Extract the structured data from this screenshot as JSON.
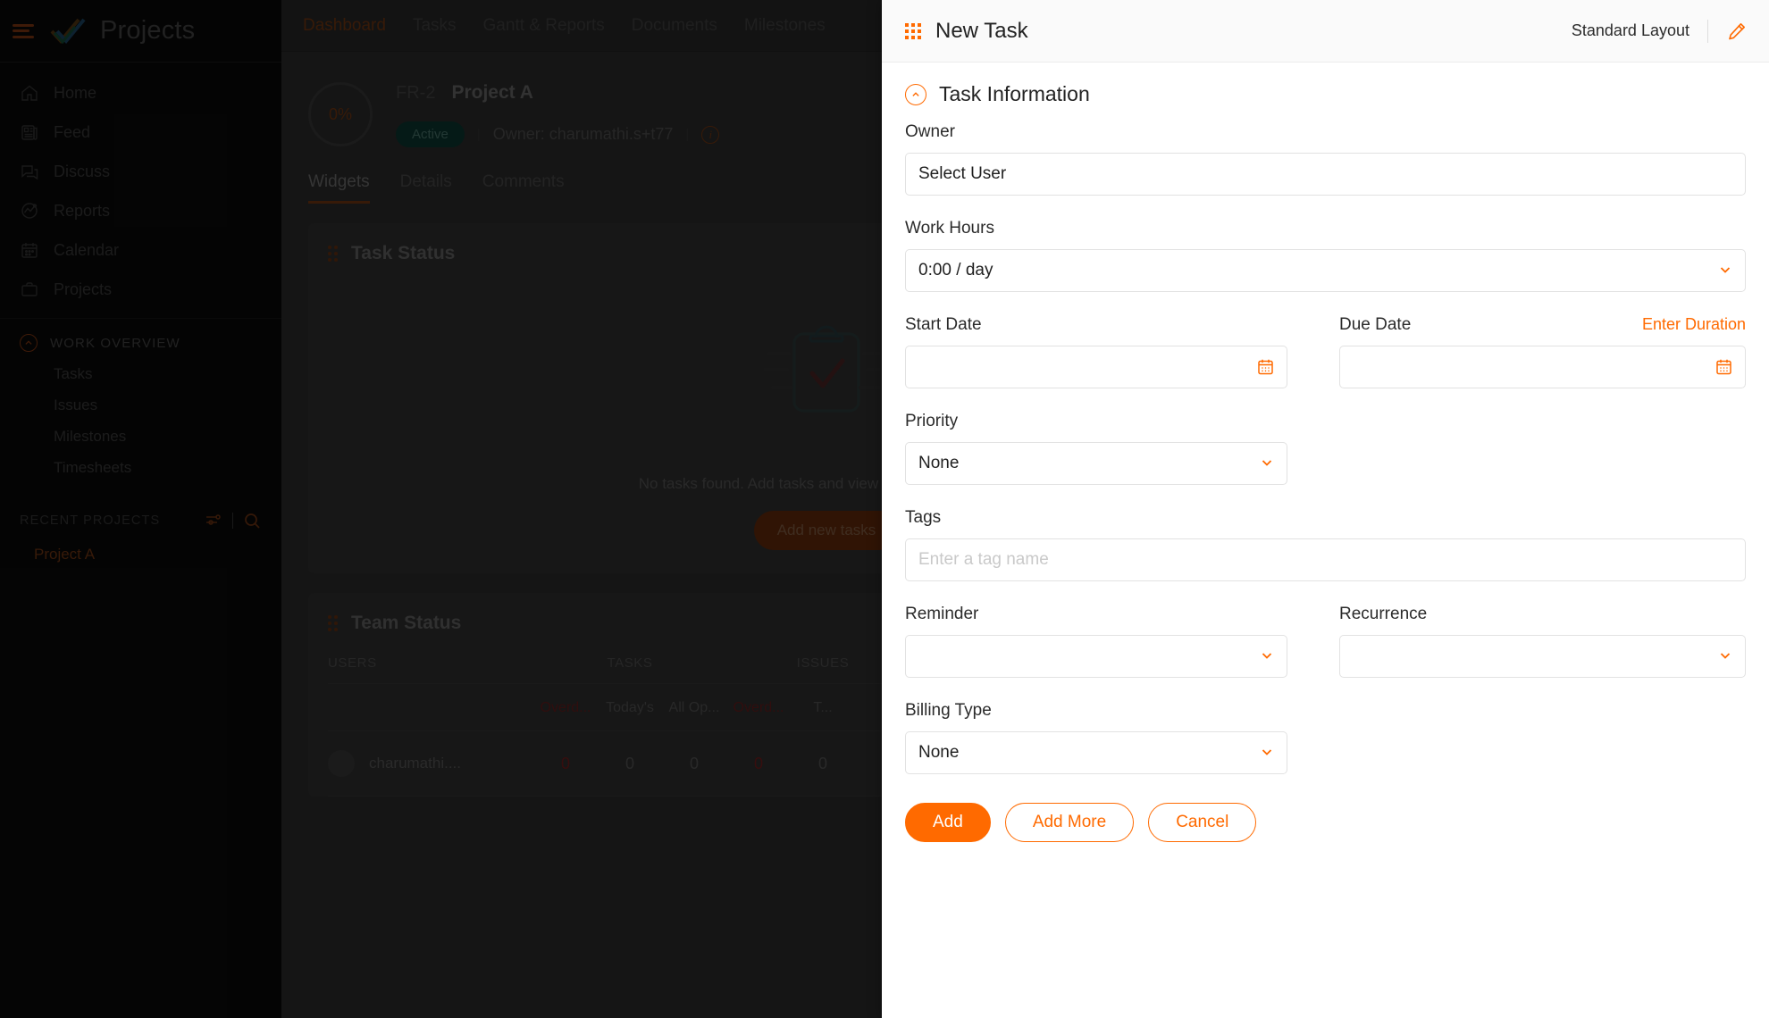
{
  "sidebar": {
    "brand": "Projects",
    "nav": [
      {
        "label": "Home",
        "icon": "home-icon"
      },
      {
        "label": "Feed",
        "icon": "feed-icon"
      },
      {
        "label": "Discuss",
        "icon": "discuss-icon"
      },
      {
        "label": "Reports",
        "icon": "reports-icon"
      },
      {
        "label": "Calendar",
        "icon": "calendar-icon"
      },
      {
        "label": "Projects",
        "icon": "projects-icon"
      }
    ],
    "work_overview": {
      "label": "WORK OVERVIEW",
      "items": [
        "Tasks",
        "Issues",
        "Milestones",
        "Timesheets"
      ]
    },
    "recent": {
      "label": "RECENT PROJECTS",
      "projects": [
        "Project A"
      ]
    }
  },
  "topbar": {
    "tabs": [
      "Dashboard",
      "Tasks",
      "Gantt & Reports",
      "Documents",
      "Milestones"
    ],
    "active": "Dashboard"
  },
  "project": {
    "progress": "0%",
    "key": "FR-2",
    "name": "Project A",
    "status": "Active",
    "owner": "Owner:  charumathi.s+t77",
    "tabs": [
      "Widgets",
      "Details",
      "Comments"
    ],
    "active_tab": "Widgets"
  },
  "task_status_widget": {
    "title": "Task Status",
    "empty_text": "No tasks found. Add tasks and view their progress here.",
    "button": "Add new tasks"
  },
  "team_status_widget": {
    "title": "Team Status",
    "groups": [
      "USERS",
      "TASKS",
      "ISSUES"
    ],
    "subheaders": [
      "Overd...",
      "Today's",
      "All Op...",
      "Overd...",
      "T..."
    ],
    "rows": [
      {
        "user": "charumathi....",
        "values": [
          "0",
          "0",
          "0",
          "0",
          "0"
        ]
      }
    ]
  },
  "panel": {
    "title": "New Task",
    "layout_label": "Standard Layout",
    "section_title": "Task Information",
    "fields": {
      "owner": {
        "label": "Owner",
        "value": "Select User"
      },
      "work_hours": {
        "label": "Work Hours",
        "value": "0:00 / day"
      },
      "start_date": {
        "label": "Start Date",
        "value": ""
      },
      "due_date": {
        "label": "Due Date",
        "value": "",
        "link": "Enter Duration"
      },
      "priority": {
        "label": "Priority",
        "value": "None"
      },
      "tags": {
        "label": "Tags",
        "placeholder": "Enter a tag name",
        "value": ""
      },
      "reminder": {
        "label": "Reminder",
        "value": ""
      },
      "recurrence": {
        "label": "Recurrence",
        "value": ""
      },
      "billing_type": {
        "label": "Billing Type",
        "value": "None"
      }
    },
    "buttons": {
      "add": "Add",
      "add_more": "Add More",
      "cancel": "Cancel"
    }
  },
  "colors": {
    "accent": "#ff6a00",
    "dim_accent": "#7a3a13",
    "panel_bg": "#ffffff",
    "app_bg": "#2f2f2f",
    "sidebar_bg": "#0b0b0b",
    "status_green": "#0d3b33",
    "overdue_red": "#7a1f1f"
  }
}
